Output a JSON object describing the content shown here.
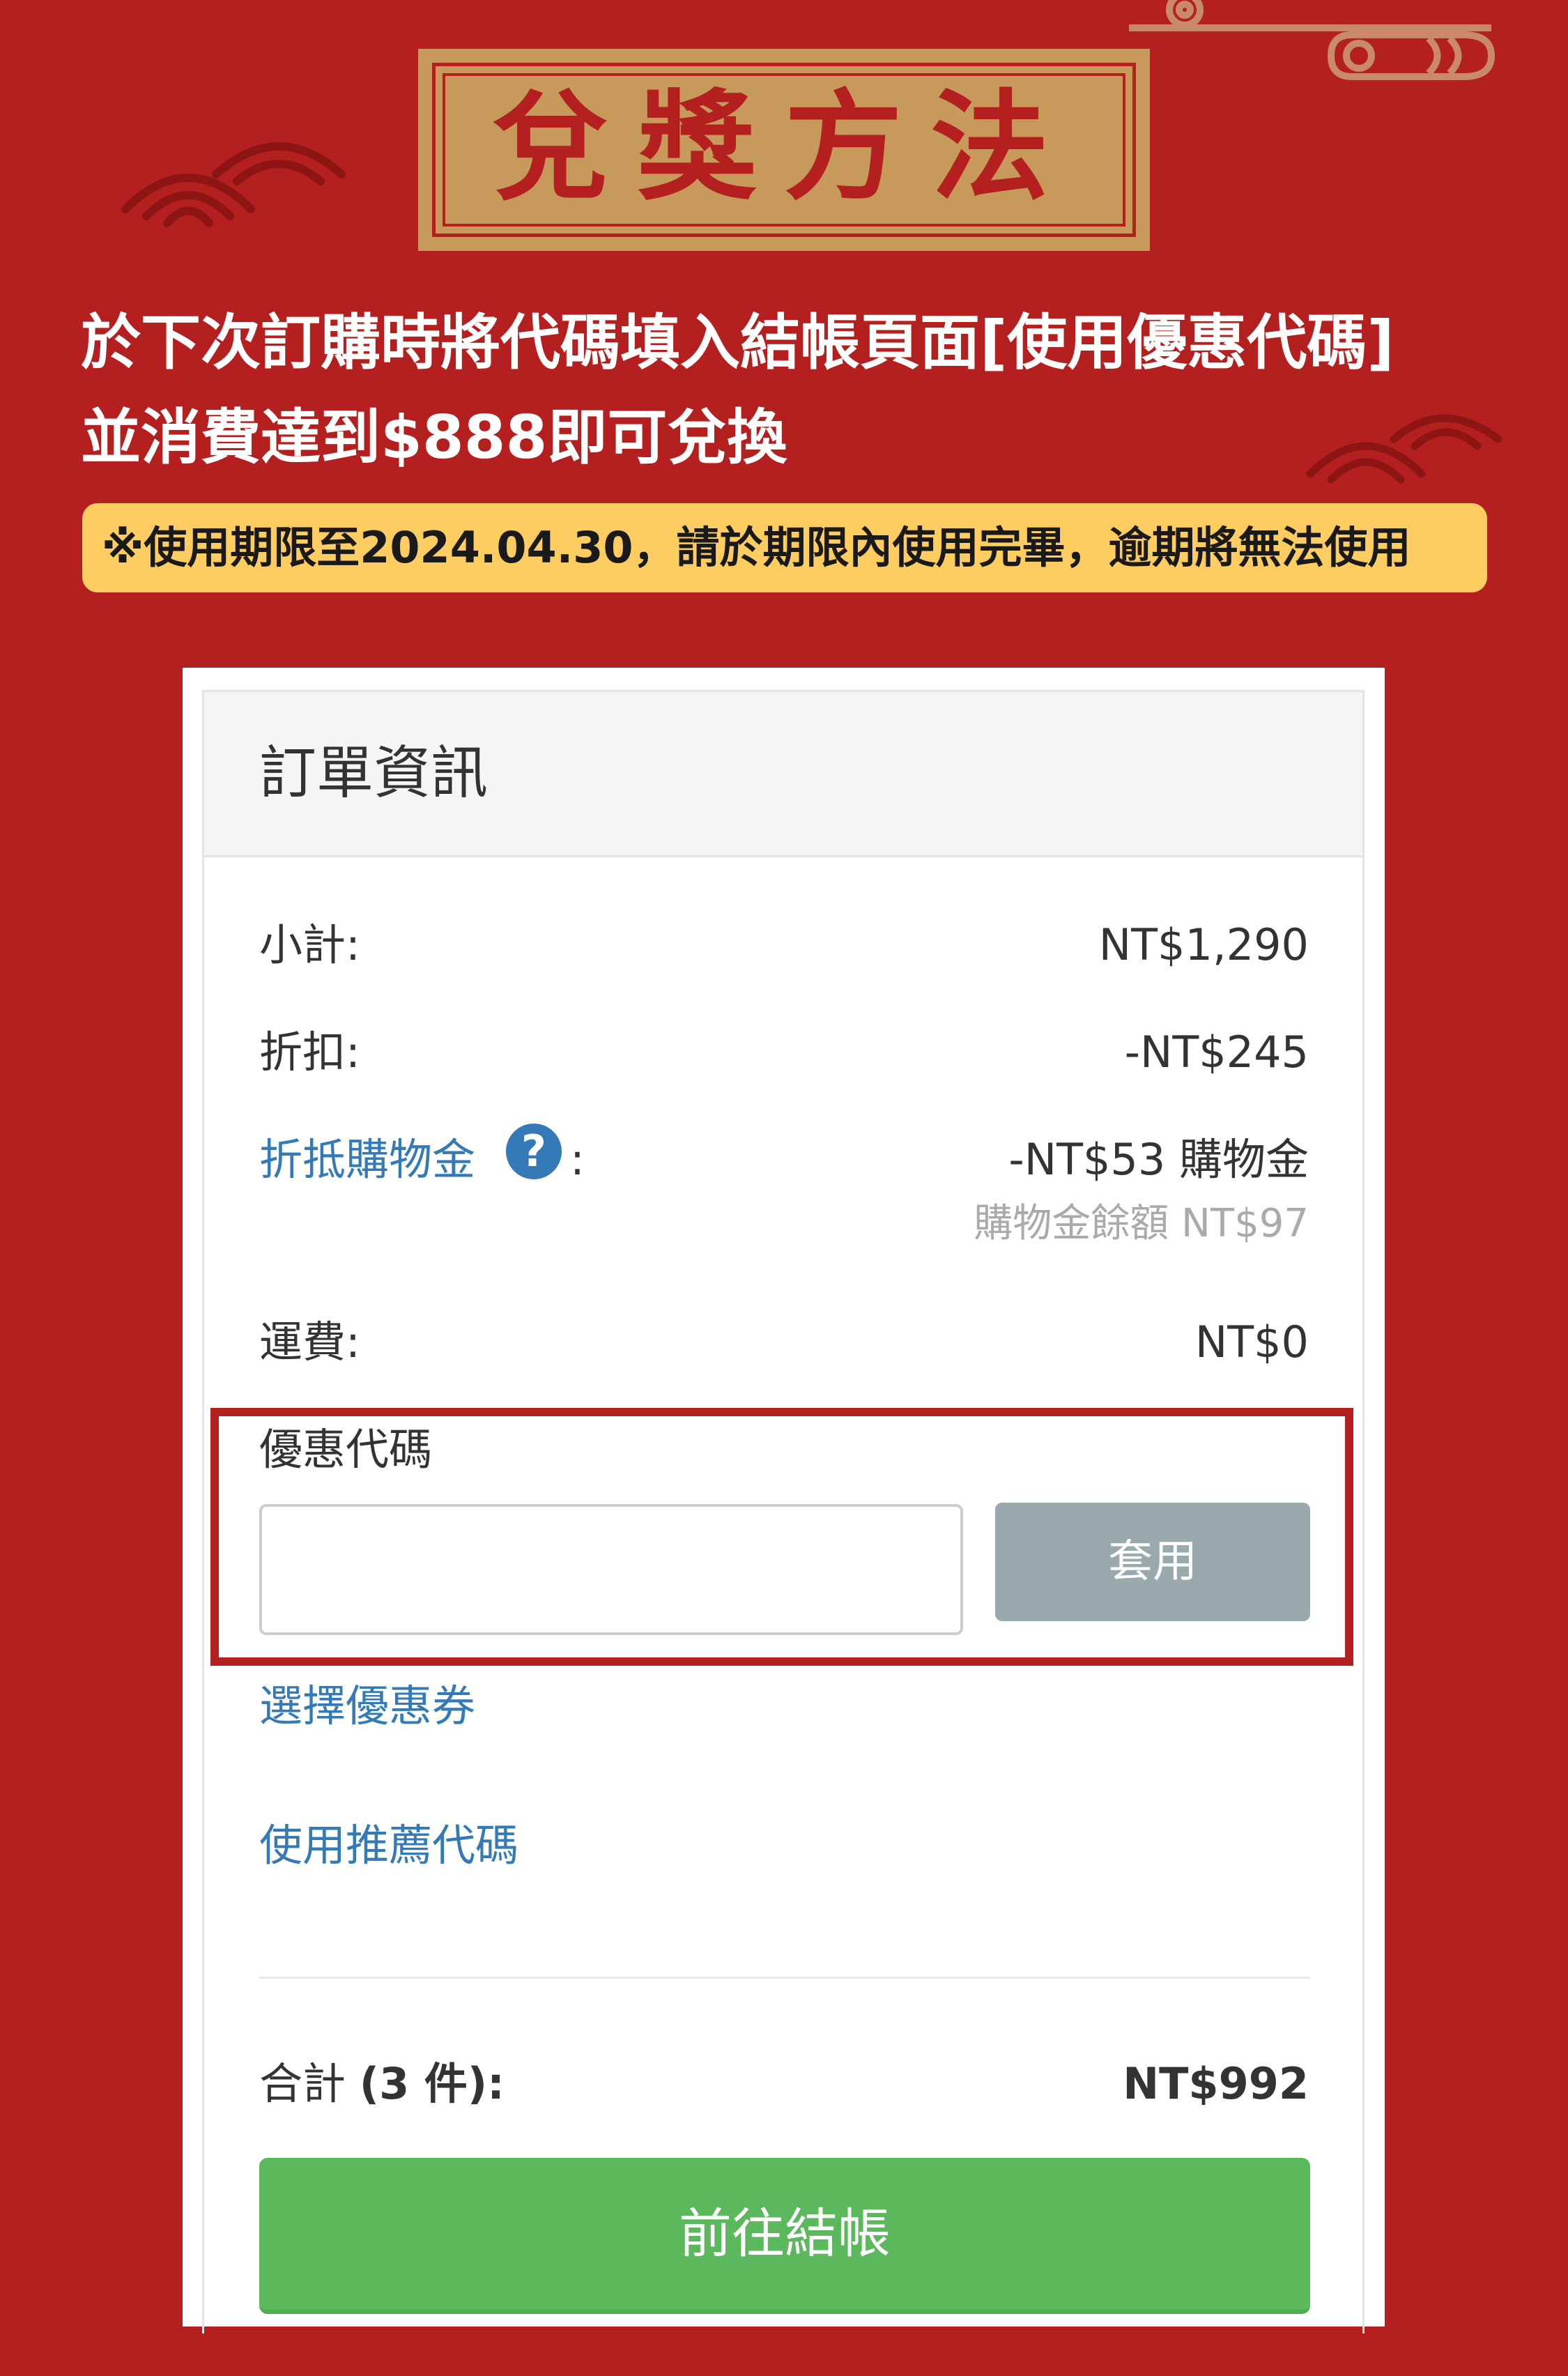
{
  "banner": {
    "title": "兌獎方法",
    "instruction_line1": "於下次訂購時將代碼填入結帳頁面[使用優惠代碼]",
    "instruction_line2": "並消費達到$888即可兌換",
    "notice": "※使用期限至2024.04.30，請於期限內使用完畢，逾期將無法使用"
  },
  "order": {
    "title": "訂單資訊",
    "subtotal_label": "小計:",
    "subtotal_value": "NT$1,290",
    "discount_label": "折扣:",
    "discount_value": "-NT$245",
    "credit_label": "折抵購物金",
    "credit_help_icon": "?",
    "credit_colon": ":",
    "credit_value": "-NT$53 購物金",
    "credit_balance": "購物金餘額 NT$97",
    "shipping_label": "運費:",
    "shipping_value": "NT$0",
    "coupon_label": "優惠代碼",
    "coupon_placeholder": "",
    "apply_button": "套用",
    "select_coupon_link": "選擇優惠券",
    "referral_link": "使用推薦代碼",
    "total_label_prefix": "合計",
    "total_label_count": "(3 件):",
    "total_value": "NT$992",
    "checkout_button": "前往結帳"
  },
  "colors": {
    "background": "#b3201f",
    "plaque": "#c79a5b",
    "notice_bg": "#fdcd62",
    "link": "#337ab7",
    "apply_button": "#9aa9ad",
    "checkout_button": "#5cb85c"
  }
}
